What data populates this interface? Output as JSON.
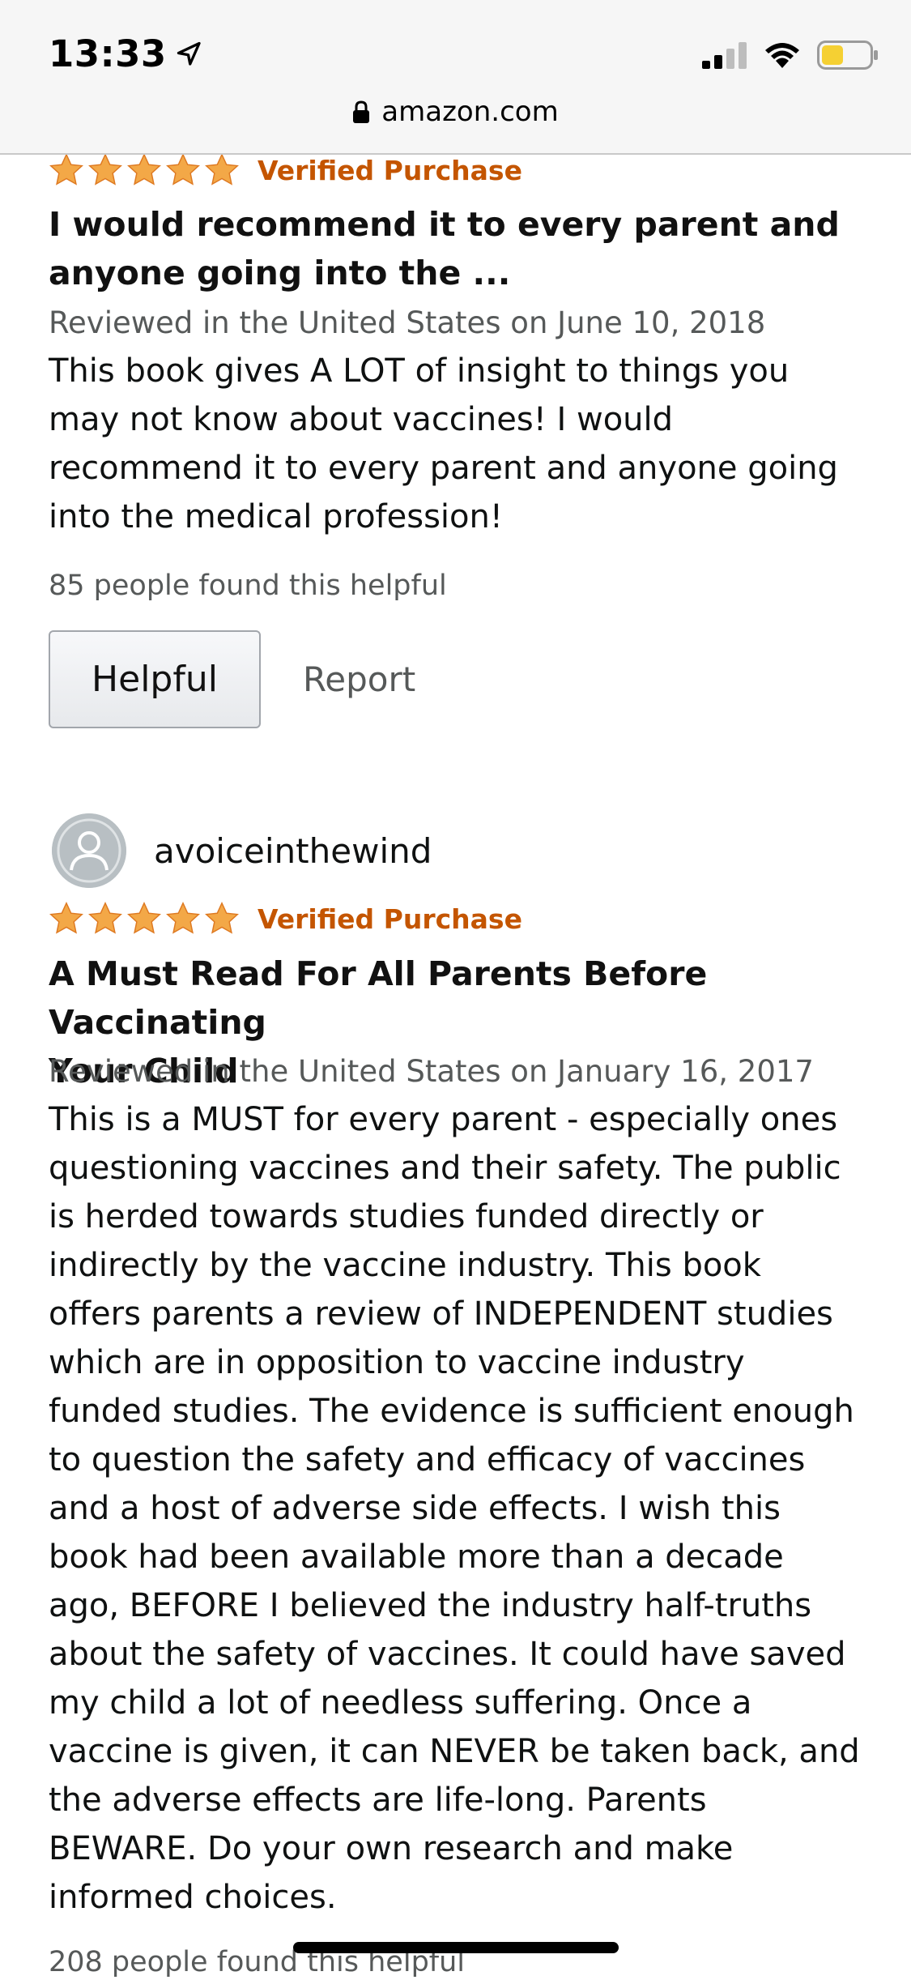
{
  "status_bar": {
    "time": "13:33"
  },
  "browser": {
    "url": "amazon.com"
  },
  "colors": {
    "star": "#f3a847",
    "verified": "#c45500",
    "muted_text": "#565959"
  },
  "reviews": [
    {
      "rating": 5,
      "verified_label": "Verified Purchase",
      "title_line1": "I would recommend it to every parent and",
      "title_line2": "anyone going into the ...",
      "date": "Reviewed in the United States on June 10, 2018",
      "body_lines": [
        "This book gives A LOT of insight to things you",
        "may not know about vaccines! I would",
        "recommend it to every parent and anyone going",
        "into the medical profession!"
      ],
      "helpful_count": "85 people found this helpful",
      "helpful_button": "Helpful",
      "report_link": "Report"
    },
    {
      "reviewer_name": "avoiceinthewind",
      "rating": 5,
      "verified_label": "Verified Purchase",
      "title_line1": "A Must Read For All Parents Before Vaccinating",
      "title_line2": "Your Child",
      "date": "Reviewed in the United States on January 16, 2017",
      "body_lines": [
        "This is a MUST for every parent - especially ones",
        "questioning vaccines and their safety. The public",
        "is herded towards studies funded directly or",
        "indirectly by the vaccine industry. This book",
        "offers parents a review of INDEPENDENT studies",
        "which are in opposition to vaccine industry",
        "funded studies. The evidence is sufficient enough",
        "to question the safety and efficacy of vaccines",
        "and a host of adverse side effects. I wish this",
        "book had been available more than a decade",
        "ago, BEFORE I believed the industry half-truths",
        "about the safety of vaccines. It could have saved",
        "my child a lot of needless suffering. Once a",
        "vaccine is given, it can NEVER be taken back, and",
        "the adverse effects are life-long. Parents",
        "BEWARE. Do your own research and make",
        "informed choices."
      ],
      "helpful_count": "208 people found this helpful"
    }
  ]
}
